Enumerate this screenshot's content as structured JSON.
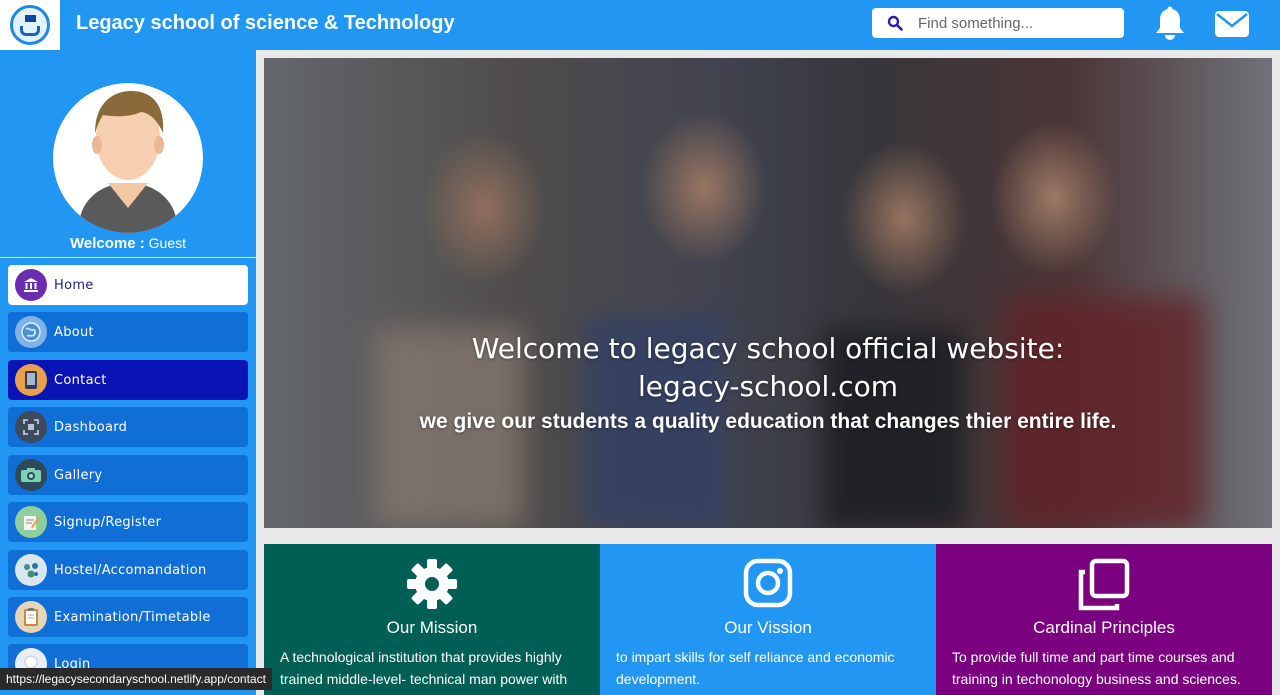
{
  "header": {
    "title": "Legacy school of science & Technology",
    "search_placeholder": "Find something..."
  },
  "sidebar": {
    "welcome_label": "Welcome :",
    "welcome_user": "Guest",
    "items": [
      {
        "label": "Home",
        "icon": "bank-icon"
      },
      {
        "label": "About",
        "icon": "globe-icon"
      },
      {
        "label": "Contact",
        "icon": "phone-icon"
      },
      {
        "label": "Dashboard",
        "icon": "dashboard-icon"
      },
      {
        "label": "Gallery",
        "icon": "camera-icon"
      },
      {
        "label": "Signup/Register",
        "icon": "signup-icon"
      },
      {
        "label": "Hostel/Accomandation",
        "icon": "hostel-icon"
      },
      {
        "label": "Examination/Timetable",
        "icon": "clipboard-icon"
      },
      {
        "label": "Login",
        "icon": "login-icon"
      }
    ]
  },
  "hero": {
    "title_line1": "Welcome to legacy school official website:",
    "title_line2": "legacy-school.com",
    "subtitle": "we give our students a quality education that changes thier entire life."
  },
  "cards": [
    {
      "title": "Our Mission",
      "text": "A technological institution that provides highly trained middle-level- technical man power with",
      "color": "#005f55",
      "icon": "gear-icon"
    },
    {
      "title": "Our Vission",
      "text": "to impart skills for self reliance and economic development.",
      "color": "#2196f3",
      "icon": "instagram-icon"
    },
    {
      "title": "Cardinal Principles",
      "text": "To provide full time and part time courses and training in techonology business and sciences.",
      "color": "#7b0080",
      "icon": "copy-icon"
    }
  ],
  "status_bar": {
    "url": "https://legacysecondaryschool.netlify.app/contact"
  },
  "colors": {
    "primary": "#2196f3",
    "sidebar_item": "#0f6fd6",
    "selected_item": "#0a14b4"
  }
}
